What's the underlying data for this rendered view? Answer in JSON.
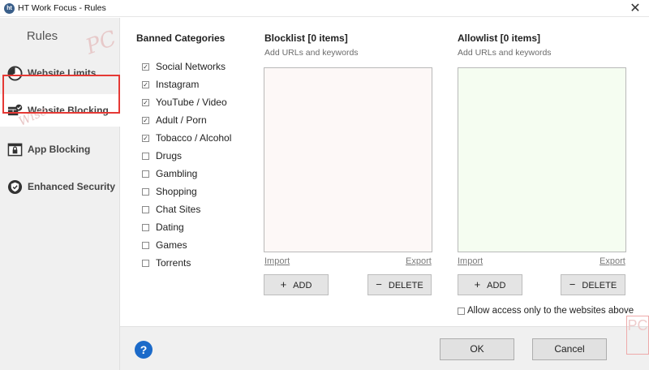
{
  "window": {
    "title": "HT Work Focus - Rules",
    "close": "✕"
  },
  "sidebar": {
    "heading": "Rules",
    "watermark": "PC",
    "watermark_script": "Wise",
    "items": [
      {
        "label": "Website Limits"
      },
      {
        "label": "Website Blocking"
      },
      {
        "label": "App Blocking"
      },
      {
        "label": "Enhanced Security"
      }
    ]
  },
  "categories": {
    "title": "Banned Categories",
    "items": [
      {
        "label": "Social Networks",
        "checked": true
      },
      {
        "label": "Instagram",
        "checked": true
      },
      {
        "label": "YouTube / Video",
        "checked": true
      },
      {
        "label": "Adult / Porn",
        "checked": true
      },
      {
        "label": "Tobacco / Alcohol",
        "checked": true
      },
      {
        "label": "Drugs",
        "checked": false
      },
      {
        "label": "Gambling",
        "checked": false
      },
      {
        "label": "Shopping",
        "checked": false
      },
      {
        "label": "Chat Sites",
        "checked": false
      },
      {
        "label": "Dating",
        "checked": false
      },
      {
        "label": "Games",
        "checked": false
      },
      {
        "label": "Torrents",
        "checked": false
      }
    ]
  },
  "blocklist": {
    "title": "Blocklist [0 items]",
    "subtitle": "Add URLs and keywords",
    "import_label": "Import",
    "export_label": "Export",
    "add_label": "ADD",
    "delete_label": "DELETE",
    "bg_color": "#fdf8f7"
  },
  "allowlist": {
    "title": "Allowlist [0 items]",
    "subtitle": "Add URLs and keywords",
    "import_label": "Import",
    "export_label": "Export",
    "add_label": "ADD",
    "delete_label": "DELETE",
    "bg_color": "#f5fdf1",
    "allow_only_label": "Allow access only to the websites above",
    "allow_only_checked": false
  },
  "footer": {
    "help": "?",
    "ok_label": "OK",
    "cancel_label": "Cancel",
    "watermark": "PC"
  },
  "colors": {
    "highlight": "#e53935",
    "help_blue": "#1b6ac9",
    "sidebar_bg": "#f0f0f0"
  }
}
